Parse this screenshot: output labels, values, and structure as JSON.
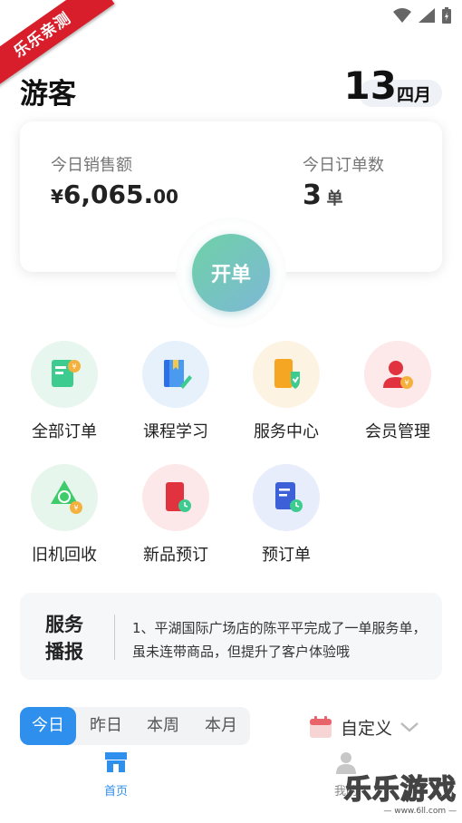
{
  "banner": {
    "text": "乐乐亲测"
  },
  "header": {
    "title": "游客",
    "day": "13",
    "month": "四月"
  },
  "sales": {
    "amount_label": "今日销售额",
    "amount_currency": "¥",
    "amount_int": "6,065.",
    "amount_dec": "00",
    "orders_label": "今日订单数",
    "orders_value": "3",
    "orders_unit": "单"
  },
  "open_button": {
    "label": "开单"
  },
  "grid": [
    {
      "label": "全部订单",
      "icon": "order-doc-icon"
    },
    {
      "label": "课程学习",
      "icon": "book-icon"
    },
    {
      "label": "服务中心",
      "icon": "service-shield-icon"
    },
    {
      "label": "会员管理",
      "icon": "member-icon"
    },
    {
      "label": "旧机回收",
      "icon": "recycle-icon"
    },
    {
      "label": "新品预订",
      "icon": "phone-clock-icon"
    },
    {
      "label": "预订单",
      "icon": "doc-clock-icon"
    }
  ],
  "news": {
    "title": "服务播报",
    "text": "1、平湖国际广场店的陈平平完成了一单服务单，虽未连带商品，但提升了客户体验哦"
  },
  "tabs": [
    "今日",
    "昨日",
    "本周",
    "本月"
  ],
  "custom": {
    "label": "自定义"
  },
  "nav": [
    {
      "label": "首页",
      "icon": "store-icon",
      "active": true
    },
    {
      "label": "我的",
      "icon": "person-icon",
      "active": false
    }
  ],
  "watermark": {
    "main": "乐乐游戏",
    "sub": "— www.6ll.com —"
  },
  "colors": {
    "accent": "#2f8fec",
    "banner": "#d81e2a",
    "open_start": "#6fd1a6",
    "open_end": "#7db8d6"
  }
}
